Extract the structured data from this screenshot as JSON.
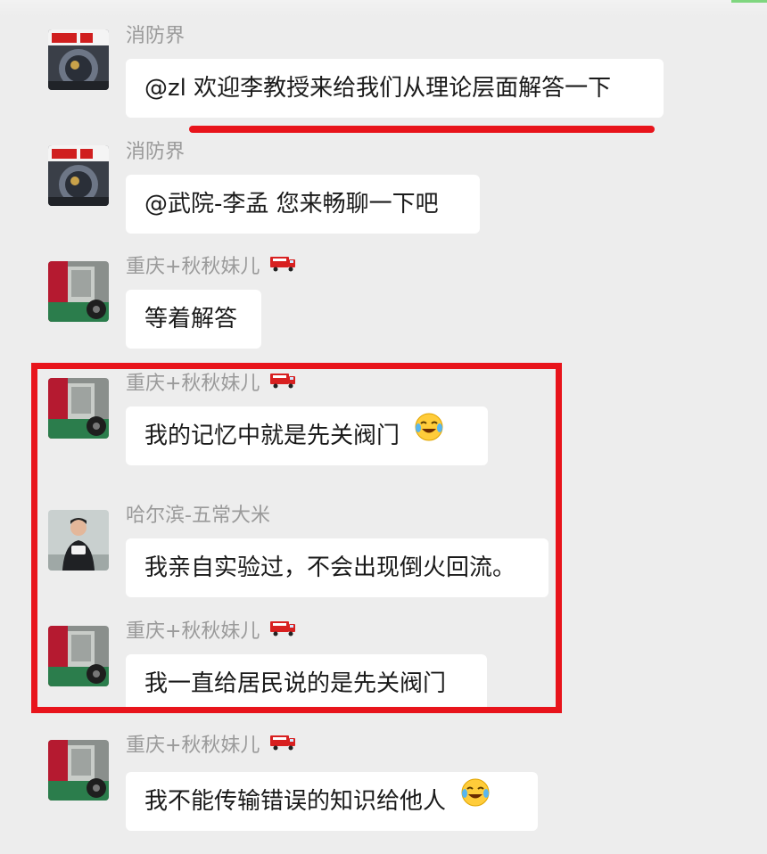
{
  "messages": [
    {
      "sender": "消防界",
      "text": "@zl 欢迎李教授来给我们从理论层面解答一下",
      "avatar": "fire-helmet-avatar",
      "emoji": null,
      "flag": null
    },
    {
      "sender": "消防界",
      "text": "@武院-李孟 您来畅聊一下吧",
      "avatar": "fire-helmet-avatar",
      "emoji": null,
      "flag": null
    },
    {
      "sender": "重庆+秋秋妹儿",
      "text": "等着解答",
      "avatar": "fire-truck-cabin-avatar",
      "emoji": null,
      "flag": "fire-truck-icon"
    },
    {
      "sender": "重庆+秋秋妹儿",
      "text": "我的记忆中就是先关阀门",
      "avatar": "fire-truck-cabin-avatar",
      "emoji": "laughing-tears-emoji",
      "flag": "fire-truck-icon"
    },
    {
      "sender": "哈尔滨-五常大米",
      "text": "我亲自实验过，不会出现倒火回流。",
      "avatar": "person-photo-avatar",
      "emoji": null,
      "flag": null
    },
    {
      "sender": "重庆+秋秋妹儿",
      "text": "我一直给居民说的是先关阀门",
      "avatar": "fire-truck-cabin-avatar",
      "emoji": null,
      "flag": "fire-truck-icon"
    },
    {
      "sender": "重庆+秋秋妹儿",
      "text": "我不能传输错误的知识给他人",
      "avatar": "fire-truck-cabin-avatar",
      "emoji": "laughing-tears-emoji",
      "flag": "fire-truck-icon"
    }
  ],
  "colors": {
    "background": "#ededed",
    "bubble": "#ffffff",
    "annotation": "#e8141b",
    "sender": "#9a9a9a"
  }
}
